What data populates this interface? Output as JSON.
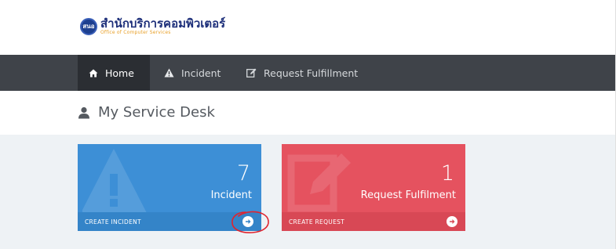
{
  "header": {
    "logo_badge": "สนอ",
    "logo_title": "สำนักบริการคอมพิวเตอร์",
    "logo_subtitle": "Office of Computer Services"
  },
  "nav": {
    "items": [
      {
        "label": "Home",
        "icon": "home-icon",
        "active": true
      },
      {
        "label": "Incident",
        "icon": "warning-icon",
        "active": false
      },
      {
        "label": "Request Fulfillment",
        "icon": "edit-icon",
        "active": false
      }
    ]
  },
  "page": {
    "title": "My Service Desk",
    "title_icon": "user-icon"
  },
  "tiles": [
    {
      "count": "7",
      "label": "Incident",
      "action": "CREATE INCIDENT",
      "color": "#3d8fd6",
      "bg_icon": "warning-icon"
    },
    {
      "count": "1",
      "label": "Request Fulfilment",
      "action": "CREATE REQUEST",
      "color": "#e5525f",
      "bg_icon": "edit-icon"
    }
  ],
  "annotation": {
    "color": "#e0232e",
    "shape": "hand-drawn-circle"
  }
}
